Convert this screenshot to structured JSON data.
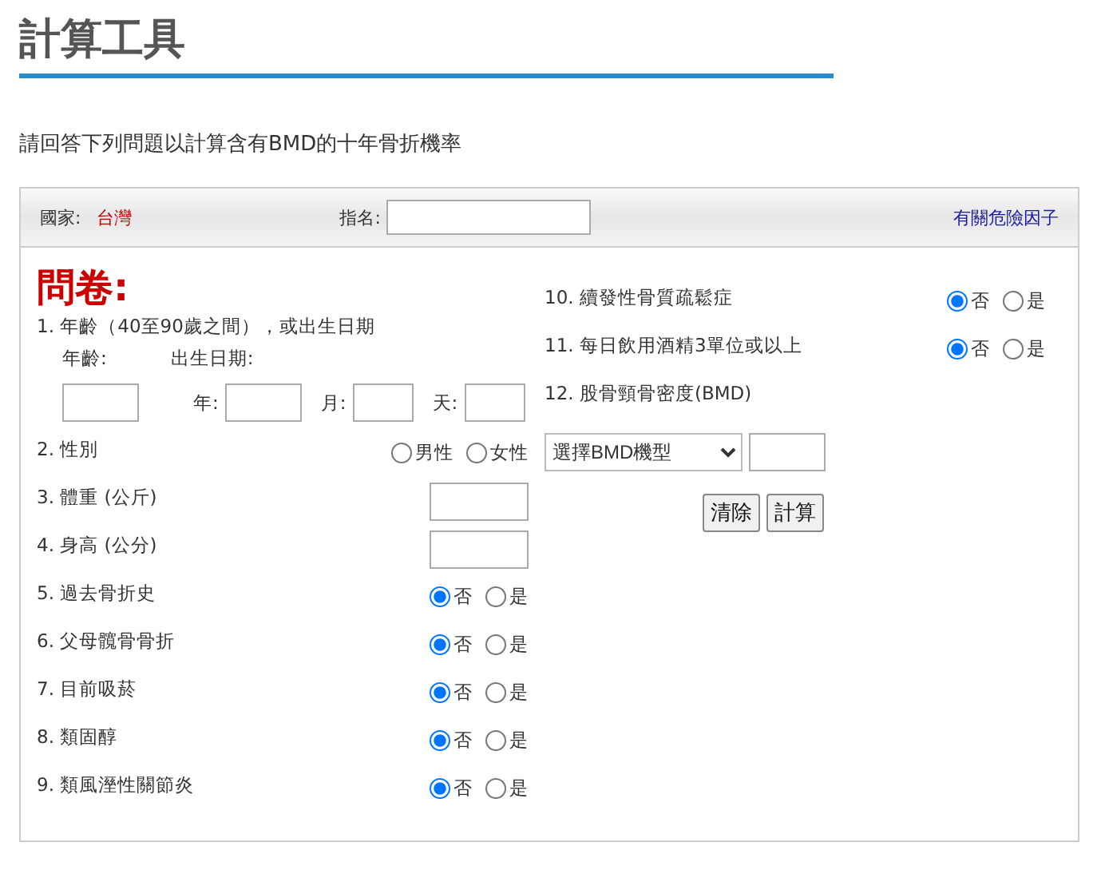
{
  "title": "計算工具",
  "intro": "請回答下列問題以計算含有BMD的十年骨折機率",
  "header": {
    "country_label": "國家:",
    "country": "台灣",
    "name_label": "指名:",
    "link": "有關危險因子"
  },
  "heading": "問卷:",
  "left": [
    {
      "kind": "age",
      "number": "1.",
      "label": "年齡（40至90歲之間），或出生日期",
      "age_label": "年齡:",
      "dob_label": "出生日期:",
      "fields": [
        {
          "label": "年:"
        },
        {
          "label": "月:"
        },
        {
          "label": "天:"
        }
      ]
    },
    {
      "kind": "radio",
      "number": "2.",
      "label": "性別",
      "options": [
        {
          "label": "男性",
          "selected": false
        },
        {
          "label": "女性",
          "selected": false
        }
      ]
    },
    {
      "kind": "input",
      "number": "3.",
      "label": "體重 (公斤)"
    },
    {
      "kind": "input",
      "number": "4.",
      "label": "身高 (公分)"
    },
    {
      "kind": "radio",
      "number": "5.",
      "label": "過去骨折史",
      "options": [
        {
          "label": "否",
          "selected": true
        },
        {
          "label": "是",
          "selected": false
        }
      ]
    },
    {
      "kind": "radio",
      "number": "6.",
      "label": "父母髖骨骨折",
      "options": [
        {
          "label": "否",
          "selected": true
        },
        {
          "label": "是",
          "selected": false
        }
      ]
    },
    {
      "kind": "radio",
      "number": "7.",
      "label": "目前吸菸",
      "options": [
        {
          "label": "否",
          "selected": true
        },
        {
          "label": "是",
          "selected": false
        }
      ]
    },
    {
      "kind": "radio",
      "number": "8.",
      "label": "類固醇",
      "options": [
        {
          "label": "否",
          "selected": true
        },
        {
          "label": "是",
          "selected": false
        }
      ]
    },
    {
      "kind": "radio",
      "number": "9.",
      "label": "類風溼性關節炎",
      "options": [
        {
          "label": "否",
          "selected": true
        },
        {
          "label": "是",
          "selected": false
        }
      ]
    }
  ],
  "right": [
    {
      "kind": "radio",
      "number": "10.",
      "label": "續發性骨質疏鬆症",
      "options": [
        {
          "label": "否",
          "selected": true
        },
        {
          "label": "是",
          "selected": false
        }
      ]
    },
    {
      "kind": "radio",
      "number": "11.",
      "label": "每日飲用酒精3單位或以上",
      "options": [
        {
          "label": "否",
          "selected": true
        },
        {
          "label": "是",
          "selected": false
        }
      ]
    },
    {
      "kind": "bmd",
      "number": "12.",
      "label": "股骨頸骨密度(BMD)",
      "select": "選擇BMD機型"
    }
  ],
  "buttons": [
    "清除",
    "計算"
  ]
}
